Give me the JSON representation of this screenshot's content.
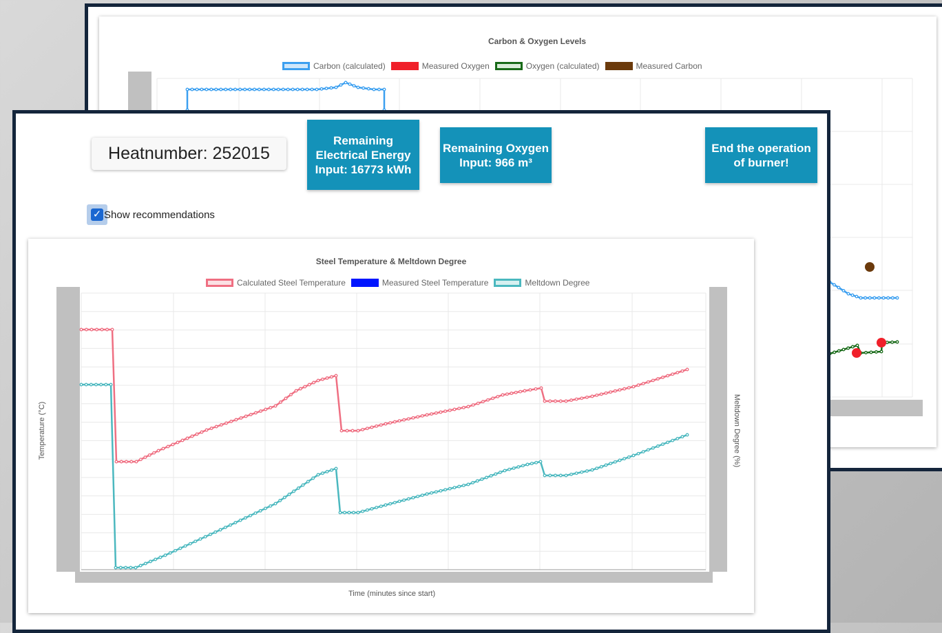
{
  "back_panel": {
    "chart": {
      "title": "Carbon & Oxygen Levels",
      "legend": [
        {
          "label": "Carbon (calculated)",
          "fill": "#cfe7fa",
          "stroke": "#3b9ff0"
        },
        {
          "label": "Measured Oxygen",
          "fill": "#f0202a",
          "stroke": "#f0202a"
        },
        {
          "label": "Oxygen (calculated)",
          "fill": "#d9ecd9",
          "stroke": "#186a18"
        },
        {
          "label": "Measured Carbon",
          "fill": "#6b3a0c",
          "stroke": "#6b3a0c"
        }
      ]
    }
  },
  "front_panel": {
    "heatnumber": "Heatnumber: 252015",
    "buttons": {
      "electrical": "Remaining Electrical Energy Input: 16773 kWh",
      "oxygen": "Remaining Oxygen Input: 966 m³",
      "burner": "End the operation of burner!"
    },
    "show_recommendations": {
      "label": "Show recommendations",
      "checked": true
    },
    "chart": {
      "title": "Steel Temperature & Meltdown Degree",
      "legend": [
        {
          "label": "Calculated Steel Temperature",
          "fill": "#fbe0e4",
          "stroke": "#ef6f82"
        },
        {
          "label": "Measured Steel Temperature",
          "fill": "#0015ff",
          "stroke": "#0015ff"
        },
        {
          "label": "Meltdown Degree",
          "fill": "#d6f0f0",
          "stroke": "#4bb8bf"
        }
      ],
      "ylabel_left": "Temperature (°C)",
      "ylabel_right": "Meltdown Degree (%)",
      "xlabel": "Time (minutes since start)"
    }
  },
  "colors": {
    "frame_border": "#14253b",
    "button_bg": "#1492b9",
    "calc_temp": "#ef6f82",
    "meltdown": "#4bb8bf",
    "carbon": "#3b9ff0",
    "oxygen": "#186a18",
    "measured_oxygen": "#f0202a",
    "measured_carbon": "#6b3a0c"
  }
}
